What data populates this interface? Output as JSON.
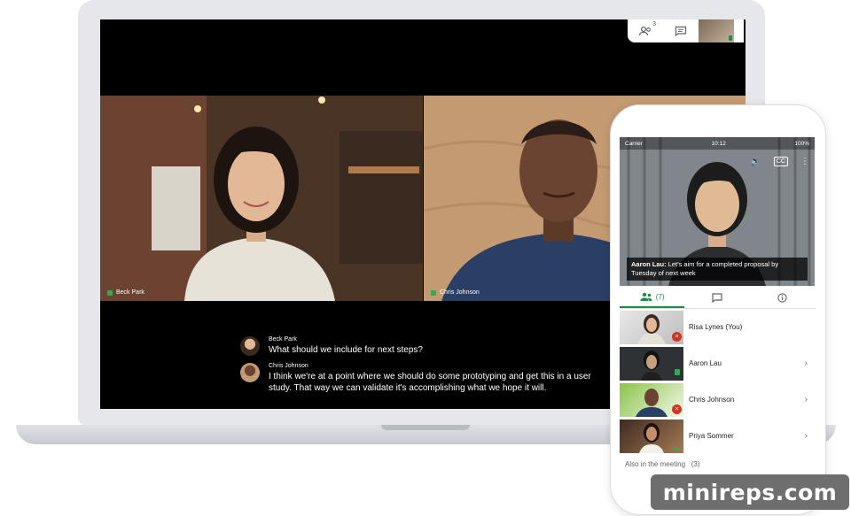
{
  "laptop": {
    "participants_count": "3",
    "tiles": [
      {
        "name": "Beck Park"
      },
      {
        "name": "Chris Johnson"
      }
    ],
    "captions": [
      {
        "speaker": "Beck Park",
        "text": "What should we include for next steps?"
      },
      {
        "speaker": "Chris Johnson",
        "text": "I think we're at a point where we should do some prototyping and get this in a user study. That way we can validate it's accomplishing what we hope it will."
      }
    ]
  },
  "phone": {
    "status": {
      "carrier": "Carrier",
      "time": "10:12",
      "battery": "100%"
    },
    "caption": {
      "speaker": "Aaron Lau:",
      "text": "Let's aim for a completed proposal by Tuesday of next week"
    },
    "tabs": {
      "people_count": "(7)"
    },
    "participants": [
      {
        "name": "Risa Lynes (You)"
      },
      {
        "name": "Aaron Lau"
      },
      {
        "name": "Chris Johnson"
      },
      {
        "name": "Priya Sommer"
      }
    ],
    "also_label": "Also in the meeting",
    "also_count": "(3)"
  },
  "icons": {
    "people": "people-icon",
    "chat": "chat-icon",
    "info": "info-icon",
    "mic_off": "mic-off-icon",
    "audio": "speaker-icon",
    "cc": "captions-icon",
    "more": "more-vert-icon",
    "chevron": "chevron-right-icon"
  },
  "colors": {
    "accent": "#1e8e3e",
    "mic_off": "#d93025"
  },
  "watermark": "minireps.com"
}
